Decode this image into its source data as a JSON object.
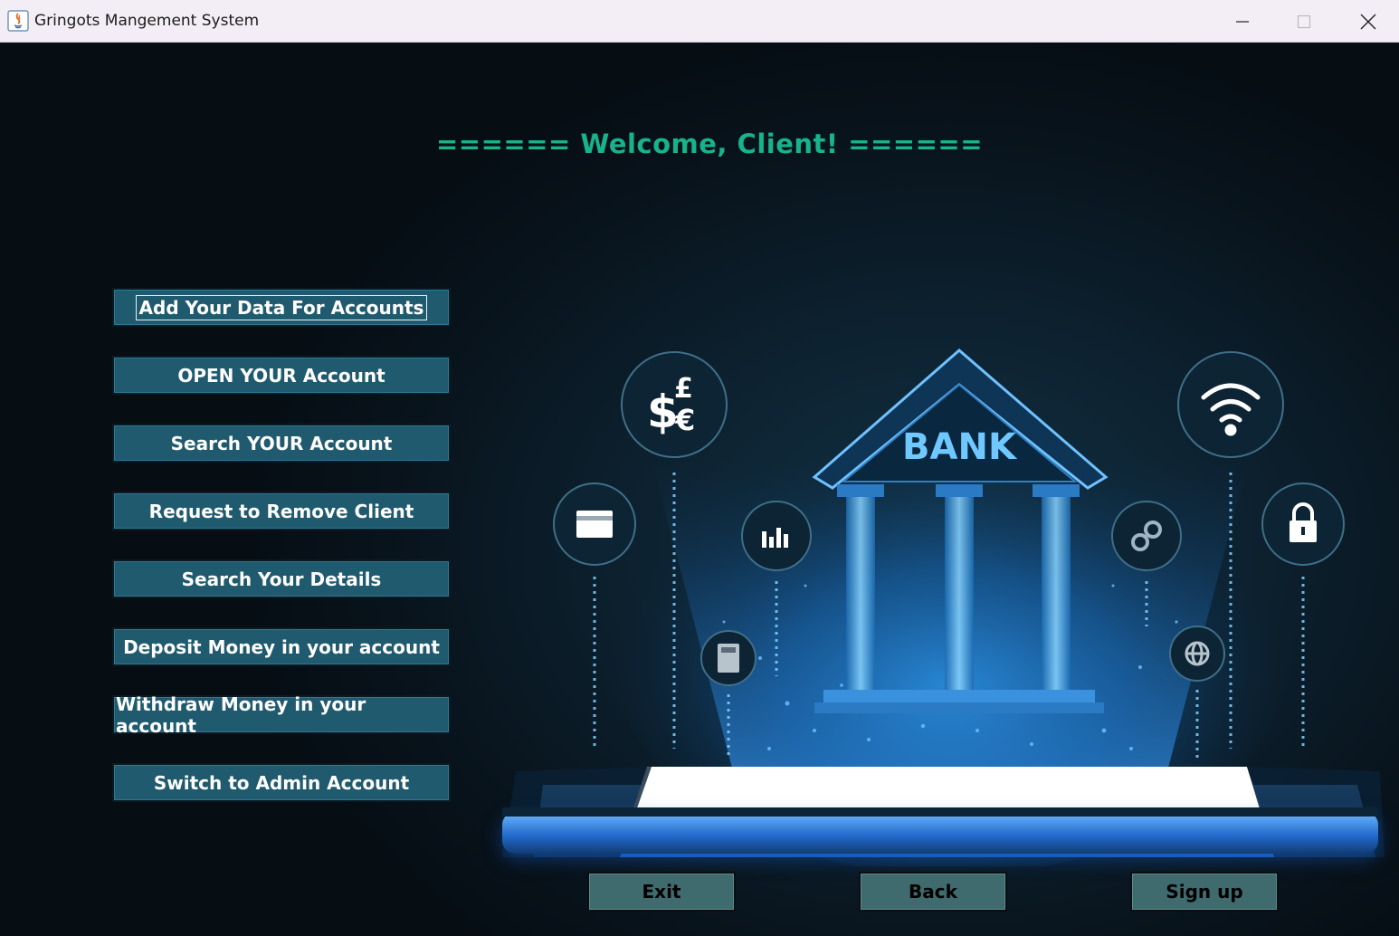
{
  "window": {
    "title": "Gringots Mangement System"
  },
  "main": {
    "welcome": "====== Welcome, Client! ======"
  },
  "menu": {
    "items": [
      {
        "label": "Add Your Data For Accounts"
      },
      {
        "label": "OPEN YOUR Account"
      },
      {
        "label": "Search YOUR Account"
      },
      {
        "label": "Request to Remove Client"
      },
      {
        "label": "Search Your Details"
      },
      {
        "label": "Deposit Money in your account"
      },
      {
        "label": "Withdraw Money in your account"
      },
      {
        "label": "Switch to Admin Account"
      }
    ]
  },
  "bottom": {
    "exit_label": "Exit",
    "back_label": "Back",
    "signup_label": "Sign up"
  },
  "illustration": {
    "sign_text": "BANK"
  },
  "colors": {
    "accent": "#18b38c",
    "button_bg": "#1f5a6e",
    "bottom_button_bg": "#3f6b6e"
  },
  "icons": [
    "java-app-icon",
    "minimize-icon",
    "maximize-icon",
    "close-icon",
    "currency-icon",
    "wifi-icon",
    "card-icon",
    "chart-icon",
    "lock-icon",
    "link-icon",
    "calculator-icon",
    "globe-icon",
    "bank-building-icon"
  ]
}
